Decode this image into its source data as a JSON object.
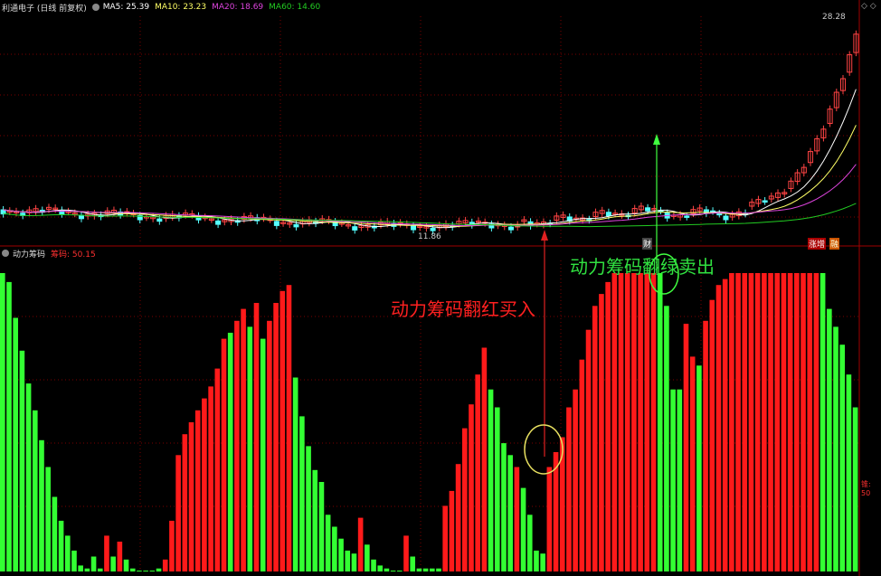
{
  "top_panel": {
    "stock_title": "利通电子 (日线 前复权)",
    "ma5_label": "MA5: 25.39",
    "ma10_label": "MA10: 23.23",
    "ma20_label": "MA20: 18.69",
    "ma60_label": "MA60: 14.60",
    "high_price_label": "28.28",
    "low_price_label": "11.86",
    "badge_cai": "财",
    "badge_zhangting": "涨增",
    "badge_shan": "融"
  },
  "bottom_panel": {
    "indicator_title": "动力筹码",
    "indicator_value_label": "筹码: 50.15",
    "right_axis_label": "锥: 50"
  },
  "annotations": {
    "buy_text": "动力筹码翻红买入",
    "sell_text": "动力筹码翻绿卖出"
  },
  "colors": {
    "up": "#ff1a1a",
    "down": "#33ff33",
    "ma5": "#ffffff",
    "ma10": "#ffff66",
    "ma20": "#dd44dd",
    "ma60": "#22cc22",
    "candle_up": "#ff4444",
    "candle_down": "#55ffff",
    "grid": "#7a0000"
  },
  "chart_data": {
    "type": "bar",
    "ylim": [
      0,
      100
    ],
    "bars": [
      {
        "v": 100,
        "c": "g"
      },
      {
        "v": 97,
        "c": "g"
      },
      {
        "v": 85,
        "c": "g"
      },
      {
        "v": 74,
        "c": "g"
      },
      {
        "v": 63,
        "c": "g"
      },
      {
        "v": 54,
        "c": "g"
      },
      {
        "v": 44,
        "c": "g"
      },
      {
        "v": 35,
        "c": "g"
      },
      {
        "v": 25,
        "c": "g"
      },
      {
        "v": 17,
        "c": "g"
      },
      {
        "v": 12,
        "c": "g"
      },
      {
        "v": 7,
        "c": "g"
      },
      {
        "v": 2,
        "c": "g"
      },
      {
        "v": 1,
        "c": "g"
      },
      {
        "v": 5,
        "c": "g"
      },
      {
        "v": 1,
        "c": "g"
      },
      {
        "v": 12,
        "c": "r"
      },
      {
        "v": 5,
        "c": "g"
      },
      {
        "v": 10,
        "c": "r"
      },
      {
        "v": 4,
        "c": "g"
      },
      {
        "v": 1,
        "c": "g"
      },
      {
        "v": 0,
        "c": "g"
      },
      {
        "v": 0,
        "c": "g"
      },
      {
        "v": 0,
        "c": "g"
      },
      {
        "v": 1,
        "c": "g"
      },
      {
        "v": 4,
        "c": "r"
      },
      {
        "v": 17,
        "c": "r"
      },
      {
        "v": 39,
        "c": "r"
      },
      {
        "v": 46,
        "c": "r"
      },
      {
        "v": 50,
        "c": "r"
      },
      {
        "v": 54,
        "c": "r"
      },
      {
        "v": 58,
        "c": "r"
      },
      {
        "v": 62,
        "c": "r"
      },
      {
        "v": 68,
        "c": "r"
      },
      {
        "v": 78,
        "c": "r"
      },
      {
        "v": 80,
        "c": "g"
      },
      {
        "v": 84,
        "c": "r"
      },
      {
        "v": 88,
        "c": "r"
      },
      {
        "v": 82,
        "c": "g"
      },
      {
        "v": 90,
        "c": "r"
      },
      {
        "v": 78,
        "c": "g"
      },
      {
        "v": 84,
        "c": "r"
      },
      {
        "v": 90,
        "c": "r"
      },
      {
        "v": 94,
        "c": "r"
      },
      {
        "v": 96,
        "c": "r"
      },
      {
        "v": 65,
        "c": "g"
      },
      {
        "v": 52,
        "c": "g"
      },
      {
        "v": 42,
        "c": "g"
      },
      {
        "v": 34,
        "c": "g"
      },
      {
        "v": 30,
        "c": "g"
      },
      {
        "v": 19,
        "c": "g"
      },
      {
        "v": 15,
        "c": "g"
      },
      {
        "v": 11,
        "c": "g"
      },
      {
        "v": 7,
        "c": "g"
      },
      {
        "v": 6,
        "c": "g"
      },
      {
        "v": 18,
        "c": "r"
      },
      {
        "v": 9,
        "c": "g"
      },
      {
        "v": 4,
        "c": "g"
      },
      {
        "v": 2,
        "c": "g"
      },
      {
        "v": 1,
        "c": "g"
      },
      {
        "v": 0,
        "c": "g"
      },
      {
        "v": 0,
        "c": "g"
      },
      {
        "v": 12,
        "c": "r"
      },
      {
        "v": 5,
        "c": "g"
      },
      {
        "v": 1,
        "c": "g"
      },
      {
        "v": 1,
        "c": "g"
      },
      {
        "v": 1,
        "c": "g"
      },
      {
        "v": 1,
        "c": "g"
      },
      {
        "v": 22,
        "c": "r"
      },
      {
        "v": 27,
        "c": "r"
      },
      {
        "v": 36,
        "c": "r"
      },
      {
        "v": 48,
        "c": "r"
      },
      {
        "v": 56,
        "c": "r"
      },
      {
        "v": 66,
        "c": "r"
      },
      {
        "v": 75,
        "c": "r"
      },
      {
        "v": 61,
        "c": "g"
      },
      {
        "v": 55,
        "c": "g"
      },
      {
        "v": 43,
        "c": "g"
      },
      {
        "v": 39,
        "c": "g"
      },
      {
        "v": 35,
        "c": "r"
      },
      {
        "v": 28,
        "c": "g"
      },
      {
        "v": 19,
        "c": "g"
      },
      {
        "v": 7,
        "c": "g"
      },
      {
        "v": 6,
        "c": "g"
      },
      {
        "v": 35,
        "c": "r"
      },
      {
        "v": 40,
        "c": "r"
      },
      {
        "v": 45,
        "c": "r"
      },
      {
        "v": 55,
        "c": "r"
      },
      {
        "v": 61,
        "c": "r"
      },
      {
        "v": 71,
        "c": "r"
      },
      {
        "v": 81,
        "c": "r"
      },
      {
        "v": 89,
        "c": "r"
      },
      {
        "v": 93,
        "c": "r"
      },
      {
        "v": 97,
        "c": "r"
      },
      {
        "v": 100,
        "c": "r"
      },
      {
        "v": 100,
        "c": "r"
      },
      {
        "v": 100,
        "c": "r"
      },
      {
        "v": 100,
        "c": "r"
      },
      {
        "v": 100,
        "c": "r"
      },
      {
        "v": 100,
        "c": "r"
      },
      {
        "v": 100,
        "c": "r"
      },
      {
        "v": 100,
        "c": "g"
      },
      {
        "v": 89,
        "c": "g"
      },
      {
        "v": 61,
        "c": "g"
      },
      {
        "v": 61,
        "c": "g"
      },
      {
        "v": 83,
        "c": "r"
      },
      {
        "v": 72,
        "c": "r"
      },
      {
        "v": 69,
        "c": "g"
      },
      {
        "v": 84,
        "c": "r"
      },
      {
        "v": 91,
        "c": "r"
      },
      {
        "v": 96,
        "c": "r"
      },
      {
        "v": 98,
        "c": "r"
      },
      {
        "v": 100,
        "c": "r"
      },
      {
        "v": 100,
        "c": "r"
      },
      {
        "v": 100,
        "c": "r"
      },
      {
        "v": 100,
        "c": "r"
      },
      {
        "v": 100,
        "c": "r"
      },
      {
        "v": 100,
        "c": "r"
      },
      {
        "v": 100,
        "c": "r"
      },
      {
        "v": 100,
        "c": "r"
      },
      {
        "v": 100,
        "c": "r"
      },
      {
        "v": 100,
        "c": "r"
      },
      {
        "v": 100,
        "c": "r"
      },
      {
        "v": 100,
        "c": "r"
      },
      {
        "v": 100,
        "c": "r"
      },
      {
        "v": 100,
        "c": "r"
      },
      {
        "v": 100,
        "c": "g"
      },
      {
        "v": 88,
        "c": "g"
      },
      {
        "v": 82,
        "c": "g"
      },
      {
        "v": 76,
        "c": "g"
      },
      {
        "v": 66,
        "c": "g"
      },
      {
        "v": 55,
        "c": "g"
      }
    ]
  }
}
